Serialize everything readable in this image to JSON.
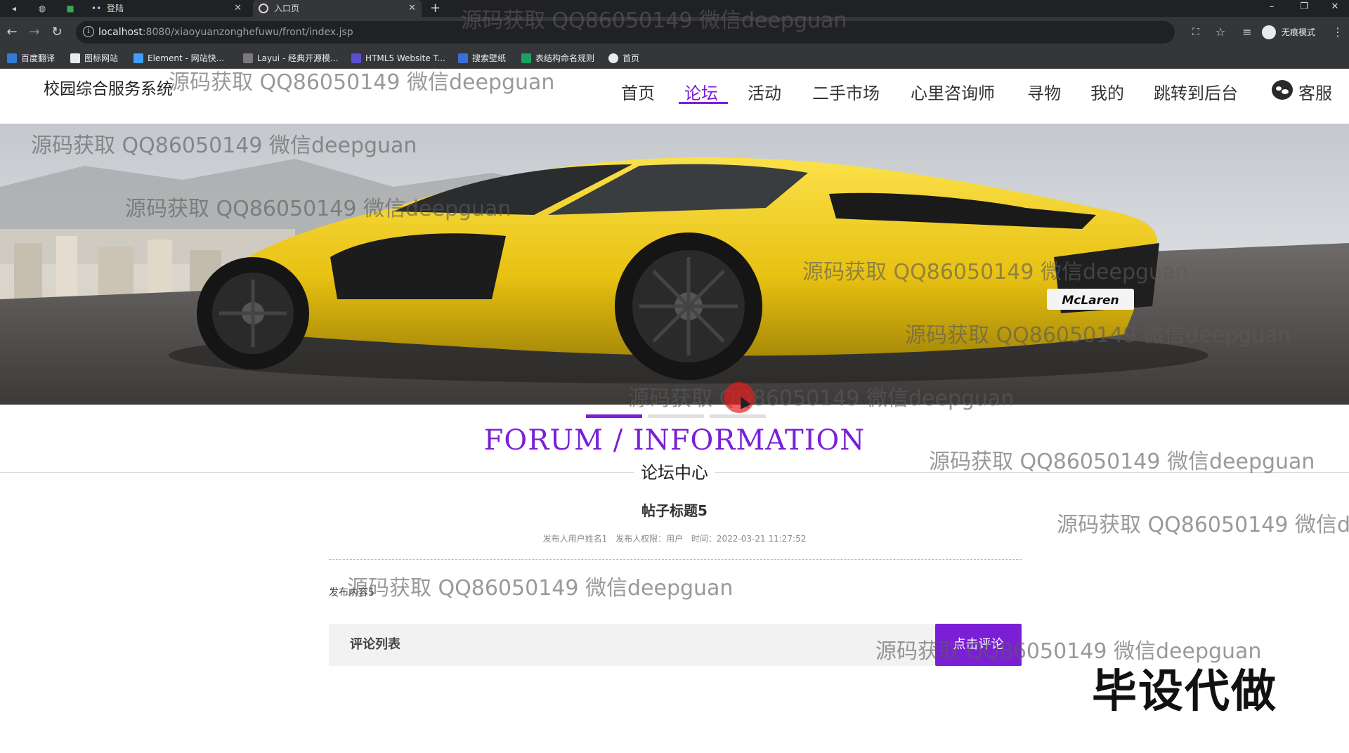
{
  "browser": {
    "tabs": [
      {
        "title": "登陆"
      },
      {
        "title": "入口页"
      }
    ],
    "url_host": "localhost",
    "url_rest": ":8080/xiaoyuanzonghefuwu/front/index.jsp",
    "profile_label": "无痕模式",
    "bookmarks": [
      "百度翻译",
      "图标网站",
      "Element - 网站快...",
      "Layui - 经典开源模...",
      "HTML5 Website T...",
      "搜索壁纸",
      "表结构命名规则",
      "首页"
    ]
  },
  "site": {
    "title": "校园综合服务系统",
    "nav": [
      "首页",
      "论坛",
      "活动",
      "二手市场",
      "心里咨询师",
      "寻物",
      "我的",
      "跳转到后台"
    ],
    "kefu": "客服"
  },
  "banner": {
    "plate": "McLaren"
  },
  "section": {
    "title_en": "FORUM / INFORMATION",
    "title_cn": "论坛中心"
  },
  "post": {
    "title": "帖子标题5",
    "author": "发布人用户姓名1",
    "role": "发布人权限：用户",
    "time": "时间：2022-03-21 11:27:52",
    "content": "发布内容5"
  },
  "comments": {
    "label": "评论列表",
    "button": "点击评论"
  },
  "overlays": {
    "watermark": "源码获取 QQ86050149 微信deepguan",
    "stamp": "毕设代做"
  },
  "colors": {
    "accent": "#7b1fd6",
    "car": "#f2cf1d"
  }
}
